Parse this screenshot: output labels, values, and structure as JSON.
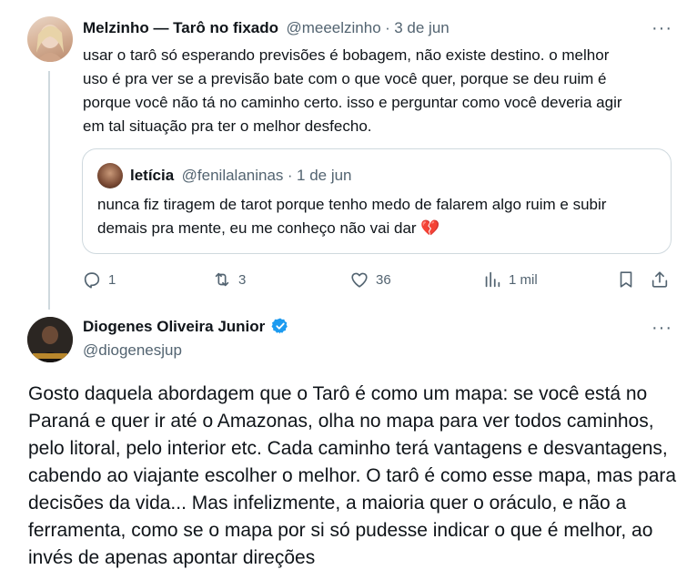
{
  "tweet1": {
    "display_name": "Melzinho — Tarô no fixado",
    "handle": "@meeelzinho",
    "separator": "·",
    "date": "3 de jun",
    "text": "usar o tarô só esperando previsões é bobagem, não existe destino. o melhor uso é pra ver se a previsão bate com o que você quer, porque se deu ruim é porque você não tá no caminho certo. isso e perguntar como você deveria agir em tal situação pra ter o melhor desfecho.",
    "more_label": "···",
    "quote": {
      "display_name": "letícia",
      "handle": "@fenilalaninas",
      "separator": "·",
      "date": "1 de jun",
      "text": "nunca fiz tiragem de tarot porque tenho medo de falarem algo ruim e subir demais pra mente, eu me conheço não vai dar 💔"
    },
    "actions": {
      "replies": "1",
      "reposts": "3",
      "likes": "36",
      "views": "1 mil"
    }
  },
  "tweet2": {
    "display_name": "Diogenes Oliveira Junior",
    "handle": "@diogenesjup",
    "more_label": "···",
    "text": "Gosto daquela abordagem que o Tarô é como um mapa: se você está no Paraná e quer ir até o Amazonas, olha no mapa para ver todos caminhos, pelo litoral, pelo interior etc. Cada caminho terá vantagens e desvantagens, cabendo ao viajante escolher o melhor. O tarô é como esse mapa, mas para decisões da vida... Mas infelizmente, a maioria quer o oráculo, e não a ferramenta, como se o mapa por si só pudesse indicar o que é melhor, ao invés de apenas apontar direções"
  },
  "colors": {
    "text": "#0f1419",
    "muted": "#536471",
    "border": "#cfd9de",
    "verified": "#1d9bf0",
    "heart_emoji": "#d3304a"
  }
}
